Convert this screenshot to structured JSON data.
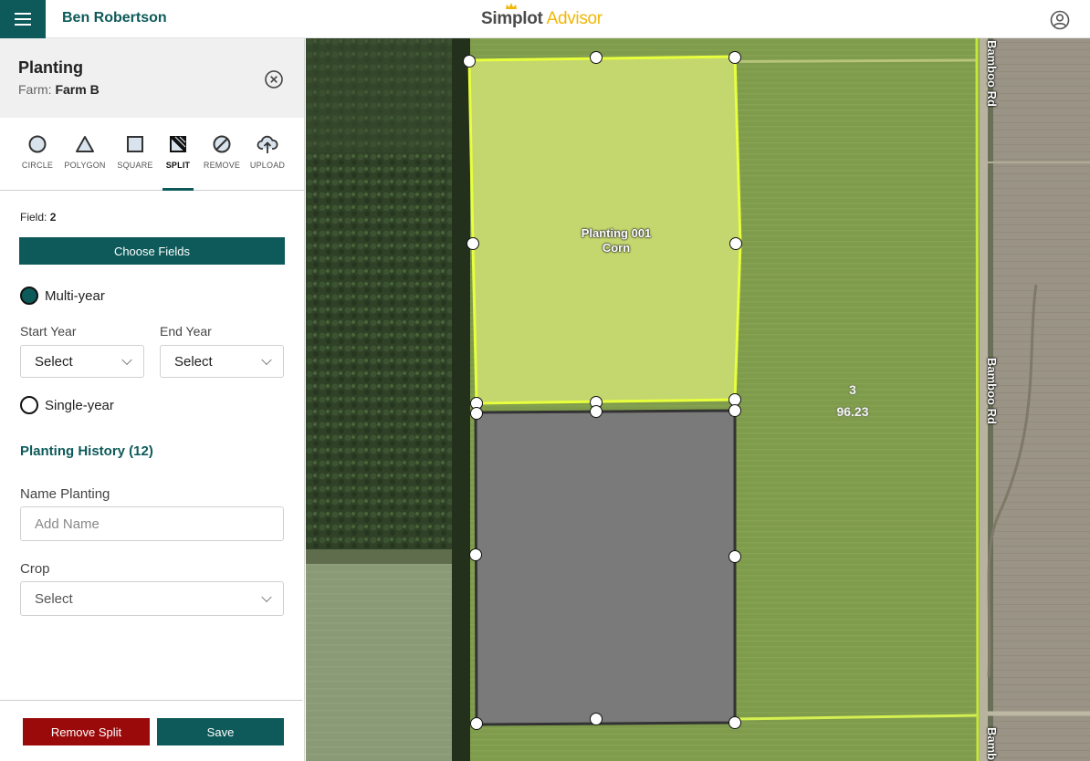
{
  "header": {
    "user_name": "Ben Robertson",
    "brand_main": "Simplot",
    "brand_sub": "Advisor",
    "menu_icon": "hamburger-menu-icon",
    "account_icon": "account-circle-icon"
  },
  "panel": {
    "title": "Planting",
    "farm_label": "Farm:",
    "farm_name": "Farm B",
    "close_icon": "close-circle-icon",
    "tools": [
      {
        "label": "CIRCLE",
        "icon": "circle-icon"
      },
      {
        "label": "POLYGON",
        "icon": "triangle-icon"
      },
      {
        "label": "SQUARE",
        "icon": "square-icon"
      },
      {
        "label": "SPLIT",
        "icon": "split-icon",
        "active": true
      },
      {
        "label": "REMOVE",
        "icon": "remove-icon"
      },
      {
        "label": "UPLOAD",
        "icon": "upload-cloud-icon"
      }
    ],
    "field_label": "Field:",
    "field_value": "2",
    "choose_fields_label": "Choose Fields",
    "multi_year_label": "Multi-year",
    "multi_year_selected": true,
    "start_year_label": "Start Year",
    "start_year_value": "Select",
    "end_year_label": "End Year",
    "end_year_value": "Select",
    "single_year_label": "Single-year",
    "planting_history_label": "Planting History (12)",
    "name_planting_label": "Name Planting",
    "name_planting_placeholder": "Add Name",
    "crop_label": "Crop",
    "crop_value": "Select",
    "remove_split_label": "Remove Split",
    "save_label": "Save"
  },
  "map": {
    "planting_name": "Planting 001",
    "planting_crop": "Corn",
    "field_number": "3",
    "field_area": "96.23",
    "road_label_1": "Bamboo Rd",
    "road_label_2": "Bamboo Rd",
    "road_label_3": "Bamb",
    "colors": {
      "selected_fill": "#c4d66e",
      "selected_border": "#e7ff3d",
      "split_fill": "#7a7a7a",
      "field_green": "#7e9a4a",
      "accent": "#0e5a5a",
      "danger": "#9b0a0a"
    }
  }
}
